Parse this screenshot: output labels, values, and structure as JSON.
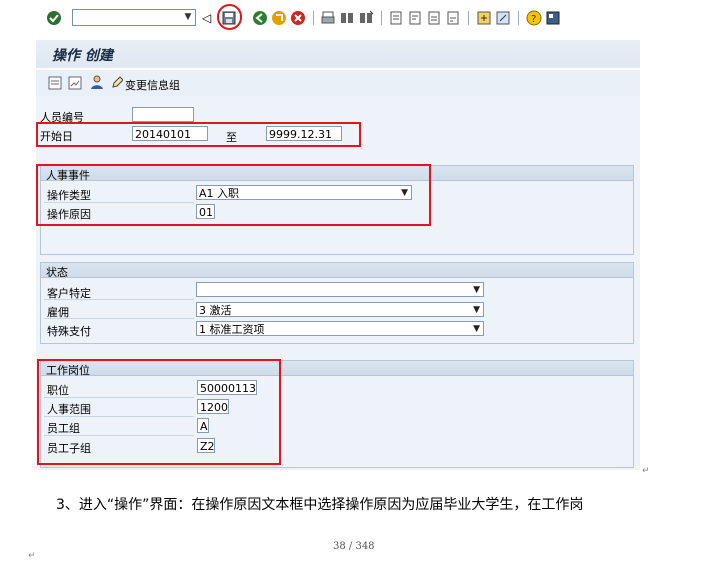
{
  "screen_title": "操作 创建",
  "app_toolbar": {
    "change_info_group_label": "变更信息组"
  },
  "header_fields": {
    "personnel_no": {
      "label": "人员编号",
      "value": ""
    },
    "start_date": {
      "label": "开始日",
      "value": "20140101"
    },
    "to_label": "至",
    "end_date": {
      "value": "9999.12.31"
    }
  },
  "personnel_action": {
    "group_title": "人事事件",
    "action_type": {
      "label": "操作类型",
      "value": "A1 入职"
    },
    "reason": {
      "label": "操作原因",
      "value": "01"
    }
  },
  "status": {
    "group_title": "状态",
    "customer_specific": {
      "label": "客户特定",
      "value": ""
    },
    "employment": {
      "label": "雇佣",
      "value": "3 激活"
    },
    "special_payment": {
      "label": "特殊支付",
      "value": "1 标准工资项"
    }
  },
  "org_assignment": {
    "group_title": "工作岗位",
    "position": {
      "label": "职位",
      "value": "50000113"
    },
    "personnel_area": {
      "label": "人事范围",
      "value": "1200"
    },
    "employee_group": {
      "label": "员工组",
      "value": "A"
    },
    "employee_subgroup": {
      "label": "员工子组",
      "value": "Z2"
    }
  },
  "document_text": "3、进入“操作”界面：在操作原因文本框中选择操作原因为应届毕业大学生，在工作岗",
  "page_number": "38 / 348",
  "colors": {
    "highlight": "#e0161c",
    "panel": "#eef3f9",
    "header": "#dbe5f1"
  }
}
